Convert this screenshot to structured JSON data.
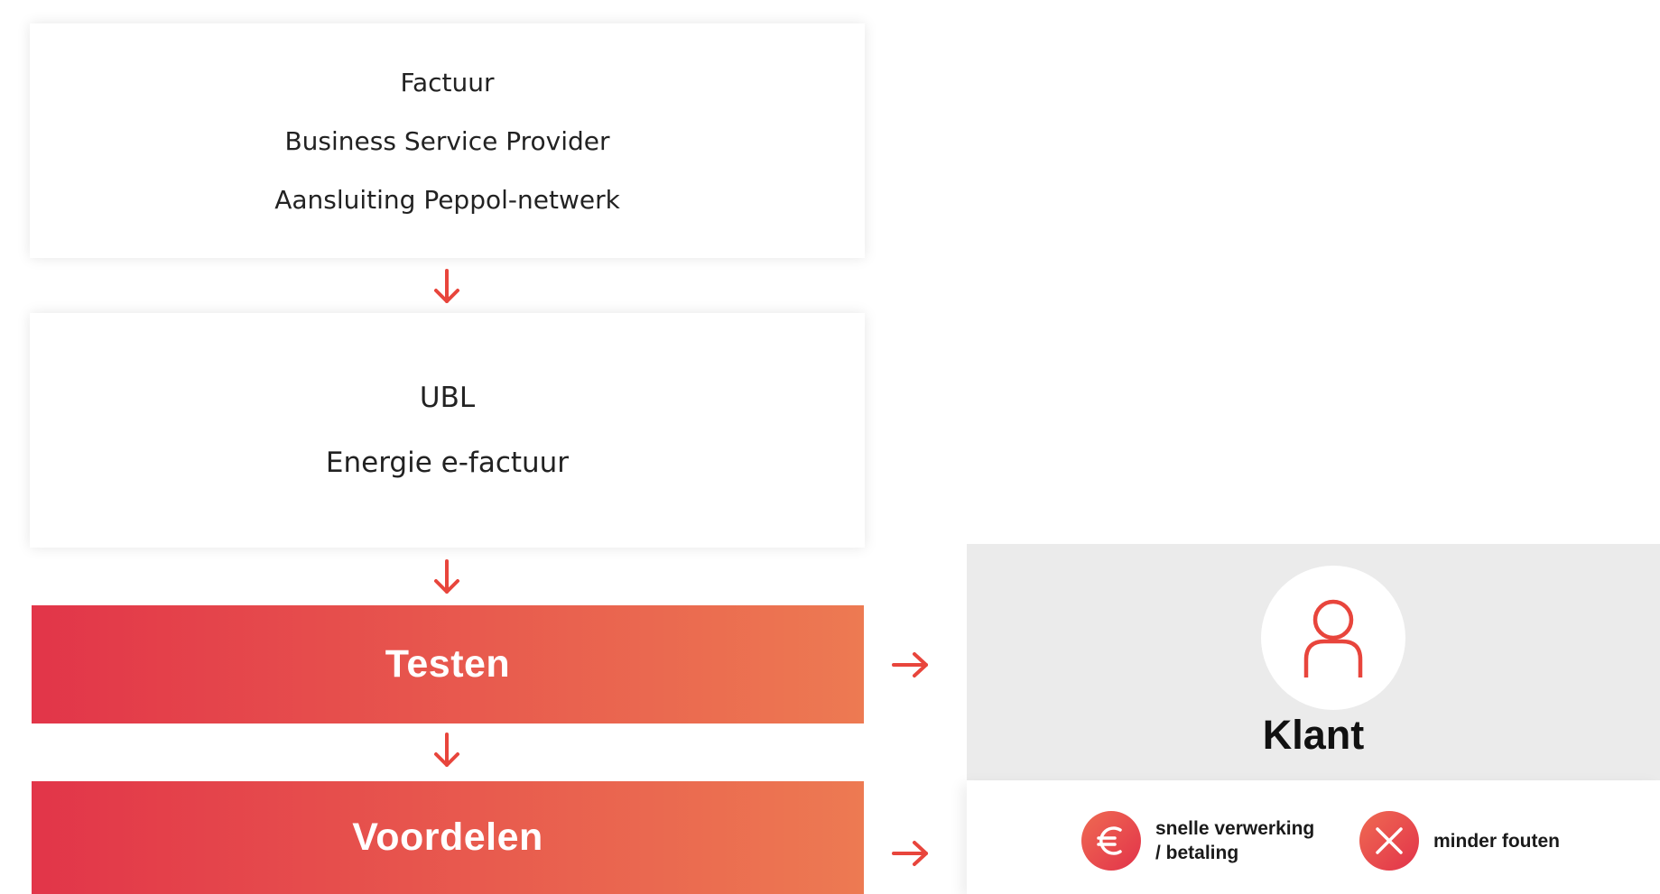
{
  "card_invoice": {
    "line1": "Factuur",
    "line2": "Business Service Provider",
    "line3": "Aansluiting Peppol-netwerk"
  },
  "card_format": {
    "line1": "UBL",
    "line2": "Energie e-factuur"
  },
  "bars": {
    "testen": "Testen",
    "voordelen": "Voordelen"
  },
  "klant": {
    "label": "Klant",
    "icon": "person-icon"
  },
  "benefits": [
    {
      "icon": "euro-icon",
      "line1": "snelle verwerking",
      "line2": "/ betaling"
    },
    {
      "icon": "cross-icon",
      "line1": "minder fouten"
    }
  ],
  "colors": {
    "accent": "#e8453c",
    "gradient_start": "#e23549",
    "gradient_end": "#ed7a52",
    "panel_gray": "#ebebeb"
  }
}
